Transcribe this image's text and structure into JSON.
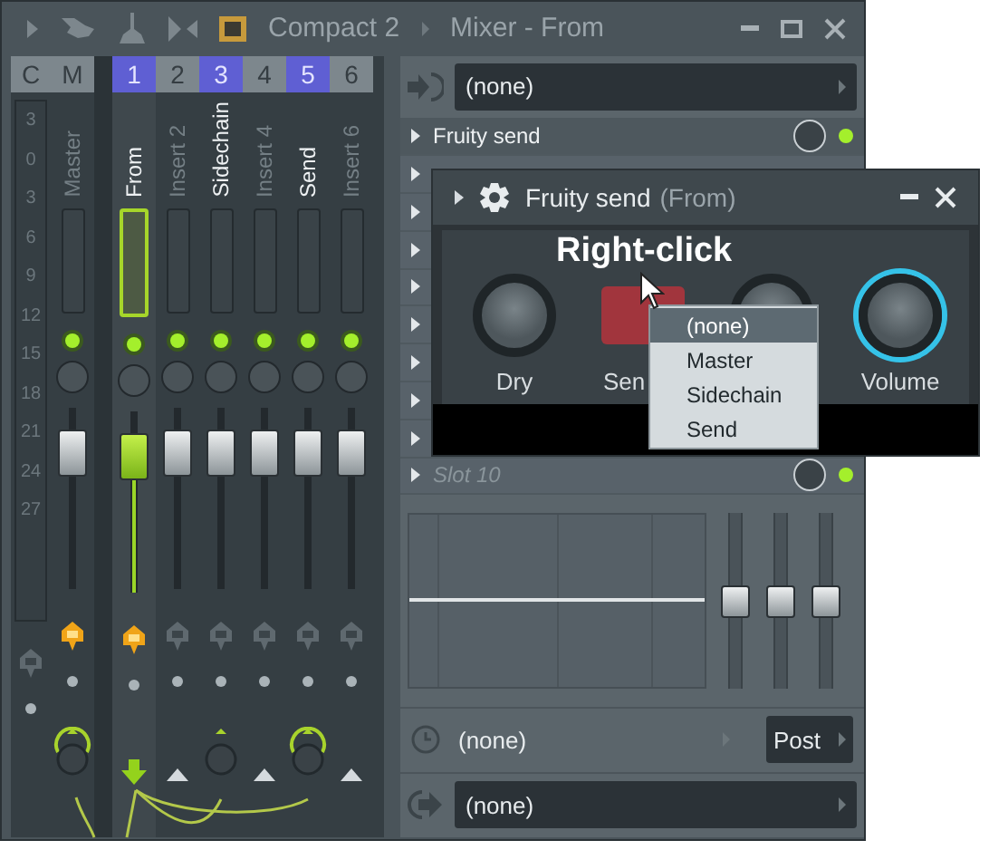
{
  "title_bar": {
    "preset": "Compact 2",
    "title": "Mixer - From"
  },
  "mixer": {
    "current": {
      "header": "C",
      "armed": false,
      "scale": [
        "3",
        "0",
        "3",
        "6",
        "9",
        "12",
        "15",
        "18",
        "21",
        "24",
        "27"
      ]
    },
    "tracks": [
      {
        "header": "M",
        "name": "Master",
        "selected": false,
        "routed": false,
        "armed": true,
        "kind": "knob-arc",
        "level": 0.84
      },
      {
        "header": "1",
        "name": "From",
        "selected": true,
        "routed": true,
        "armed": true,
        "kind": "arrow",
        "level": 0.84
      },
      {
        "header": "2",
        "name": "Insert 2",
        "selected": false,
        "routed": false,
        "armed": false,
        "kind": "triangle",
        "level": 0.84
      },
      {
        "header": "3",
        "name": "Sidechain",
        "selected": false,
        "routed": true,
        "armed": false,
        "kind": "knob",
        "level": 0.84
      },
      {
        "header": "4",
        "name": "Insert 4",
        "selected": false,
        "routed": false,
        "armed": false,
        "kind": "triangle",
        "level": 0.84
      },
      {
        "header": "5",
        "name": "Send",
        "selected": false,
        "routed": true,
        "armed": false,
        "kind": "knob-arc",
        "level": 0.84
      },
      {
        "header": "6",
        "name": "Insert 6",
        "selected": false,
        "routed": false,
        "armed": false,
        "kind": "triangle",
        "level": 0.84
      }
    ]
  },
  "inserts": {
    "input": "(none)",
    "slots": [
      {
        "kind": "plugin",
        "name": "Fruity send",
        "on": true
      },
      {
        "kind": "covered"
      },
      {
        "kind": "covered"
      },
      {
        "kind": "covered"
      },
      {
        "kind": "covered"
      },
      {
        "kind": "covered"
      },
      {
        "kind": "covered"
      },
      {
        "kind": "covered"
      },
      {
        "kind": "covered"
      },
      {
        "kind": "empty",
        "name": "Slot 10",
        "on": true
      }
    ],
    "eq": [
      {
        "level": 0.5
      },
      {
        "level": 0.5
      },
      {
        "level": 0.5
      }
    ],
    "send_target": "(none)",
    "position": "Post",
    "output": "(none)"
  },
  "plugin_window": {
    "title": "Fruity send",
    "subtitle": "(From)",
    "hint": "Right-click",
    "controls": [
      {
        "kind": "knob",
        "label": "Dry",
        "selected": false
      },
      {
        "kind": "send-box",
        "label": "Sen",
        "selected": false
      },
      {
        "kind": "knob",
        "selected": false
      },
      {
        "kind": "knob",
        "label": "Volume",
        "selected": true
      }
    ]
  },
  "context_menu": {
    "items": [
      {
        "label": "(none)",
        "selected": true
      },
      {
        "label": "Master",
        "selected": false
      },
      {
        "label": "Sidechain",
        "selected": false
      },
      {
        "label": "Send",
        "selected": false
      }
    ]
  }
}
